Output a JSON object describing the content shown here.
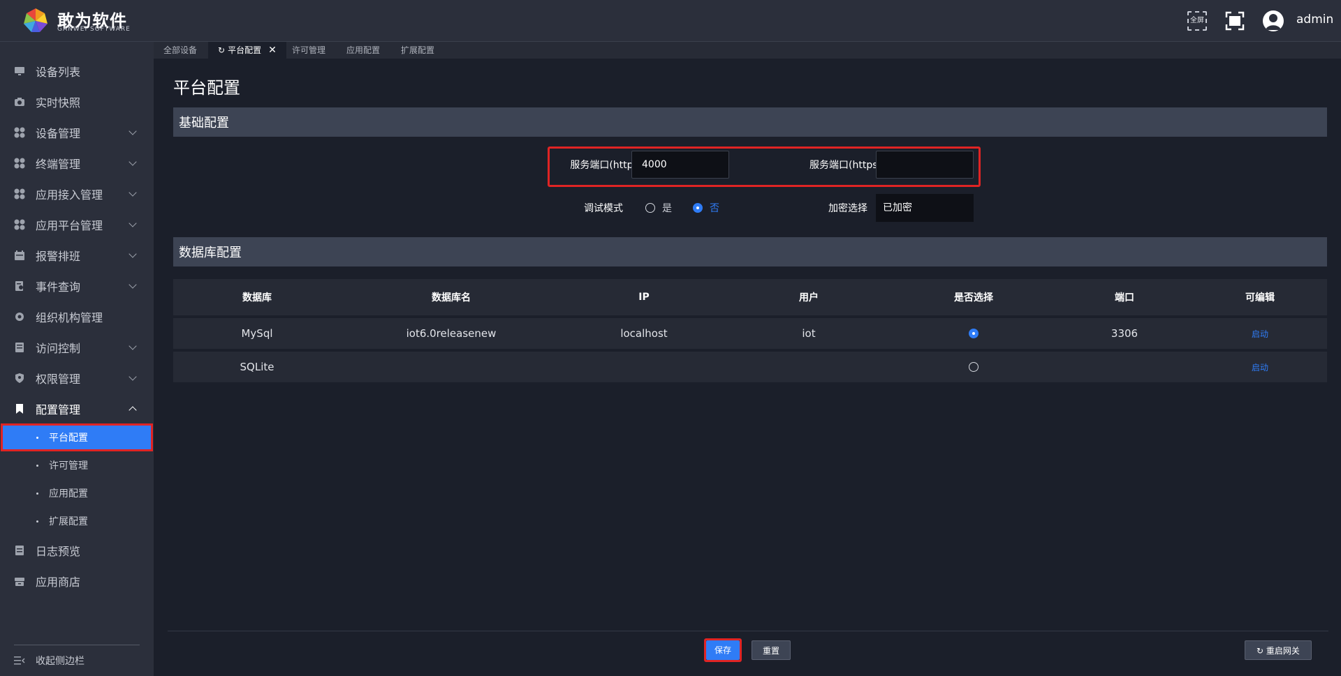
{
  "header": {
    "brand_cn": "敢为软件",
    "brand_en": "GANWEI  SOFTWARE",
    "fullscreen_text": "全屏",
    "username": "admin"
  },
  "sidebar": {
    "items": [
      {
        "label": "设备列表",
        "icon": "monitor-icon",
        "has_children": false
      },
      {
        "label": "实时快照",
        "icon": "camera-icon",
        "has_children": false
      },
      {
        "label": "设备管理",
        "icon": "apps-icon",
        "has_children": true
      },
      {
        "label": "终端管理",
        "icon": "apps-icon",
        "has_children": true
      },
      {
        "label": "应用接入管理",
        "icon": "apps-icon",
        "has_children": true
      },
      {
        "label": "应用平台管理",
        "icon": "apps-icon",
        "has_children": true
      },
      {
        "label": "报警排班",
        "icon": "calendar-icon",
        "has_children": true
      },
      {
        "label": "事件查询",
        "icon": "document-search-icon",
        "has_children": true
      },
      {
        "label": "组织机构管理",
        "icon": "gear-icon",
        "has_children": false
      },
      {
        "label": "访问控制",
        "icon": "clipboard-icon",
        "has_children": true
      },
      {
        "label": "权限管理",
        "icon": "shield-icon",
        "has_children": true
      },
      {
        "label": "配置管理",
        "icon": "bookmark-icon",
        "has_children": true,
        "expanded": true
      }
    ],
    "sub_items": [
      {
        "label": "平台配置",
        "active": true
      },
      {
        "label": "许可管理",
        "active": false
      },
      {
        "label": "应用配置",
        "active": false
      },
      {
        "label": "扩展配置",
        "active": false
      }
    ],
    "bottom_items": [
      {
        "label": "日志预览",
        "icon": "log-icon"
      },
      {
        "label": "应用商店",
        "icon": "store-icon"
      }
    ],
    "collapse_label": "收起侧边栏"
  },
  "tabs": [
    {
      "label": "全部设备",
      "active": false
    },
    {
      "label": "平台配置",
      "active": true
    },
    {
      "label": "许可管理",
      "active": false
    },
    {
      "label": "应用配置",
      "active": false
    },
    {
      "label": "扩展配置",
      "active": false
    }
  ],
  "main": {
    "title": "平台配置",
    "basic_section": "基础配置",
    "http_port_label": "服务端口(http)",
    "http_port_value": "4000",
    "https_port_label": "服务端口(https)",
    "https_port_value": "",
    "debug_mode_label": "调试模式",
    "debug_yes": "是",
    "debug_no": "否",
    "debug_selected": "否",
    "encrypt_label": "加密选择",
    "encrypt_value": "已加密",
    "db_section": "数据库配置"
  },
  "db_table": {
    "columns": [
      "数据库",
      "数据库名",
      "IP",
      "用户",
      "是否选择",
      "端口",
      "可编辑"
    ],
    "rows": [
      {
        "db": "MySql",
        "db_name": "iot6.0releasenew",
        "ip": "localhost",
        "user": "iot",
        "selected": true,
        "port": "3306",
        "edit": "启动"
      },
      {
        "db": "SQLite",
        "db_name": "",
        "ip": "",
        "user": "",
        "selected": false,
        "port": "",
        "edit": "启动"
      }
    ]
  },
  "footer": {
    "save_label": "保存",
    "reset_label": "重置",
    "restart_label": "重启网关"
  },
  "colors": {
    "accent": "#2f7cf6",
    "highlight": "#e02424",
    "sidebar_bg": "#2b2f3b",
    "main_bg": "#1b1f2a"
  }
}
